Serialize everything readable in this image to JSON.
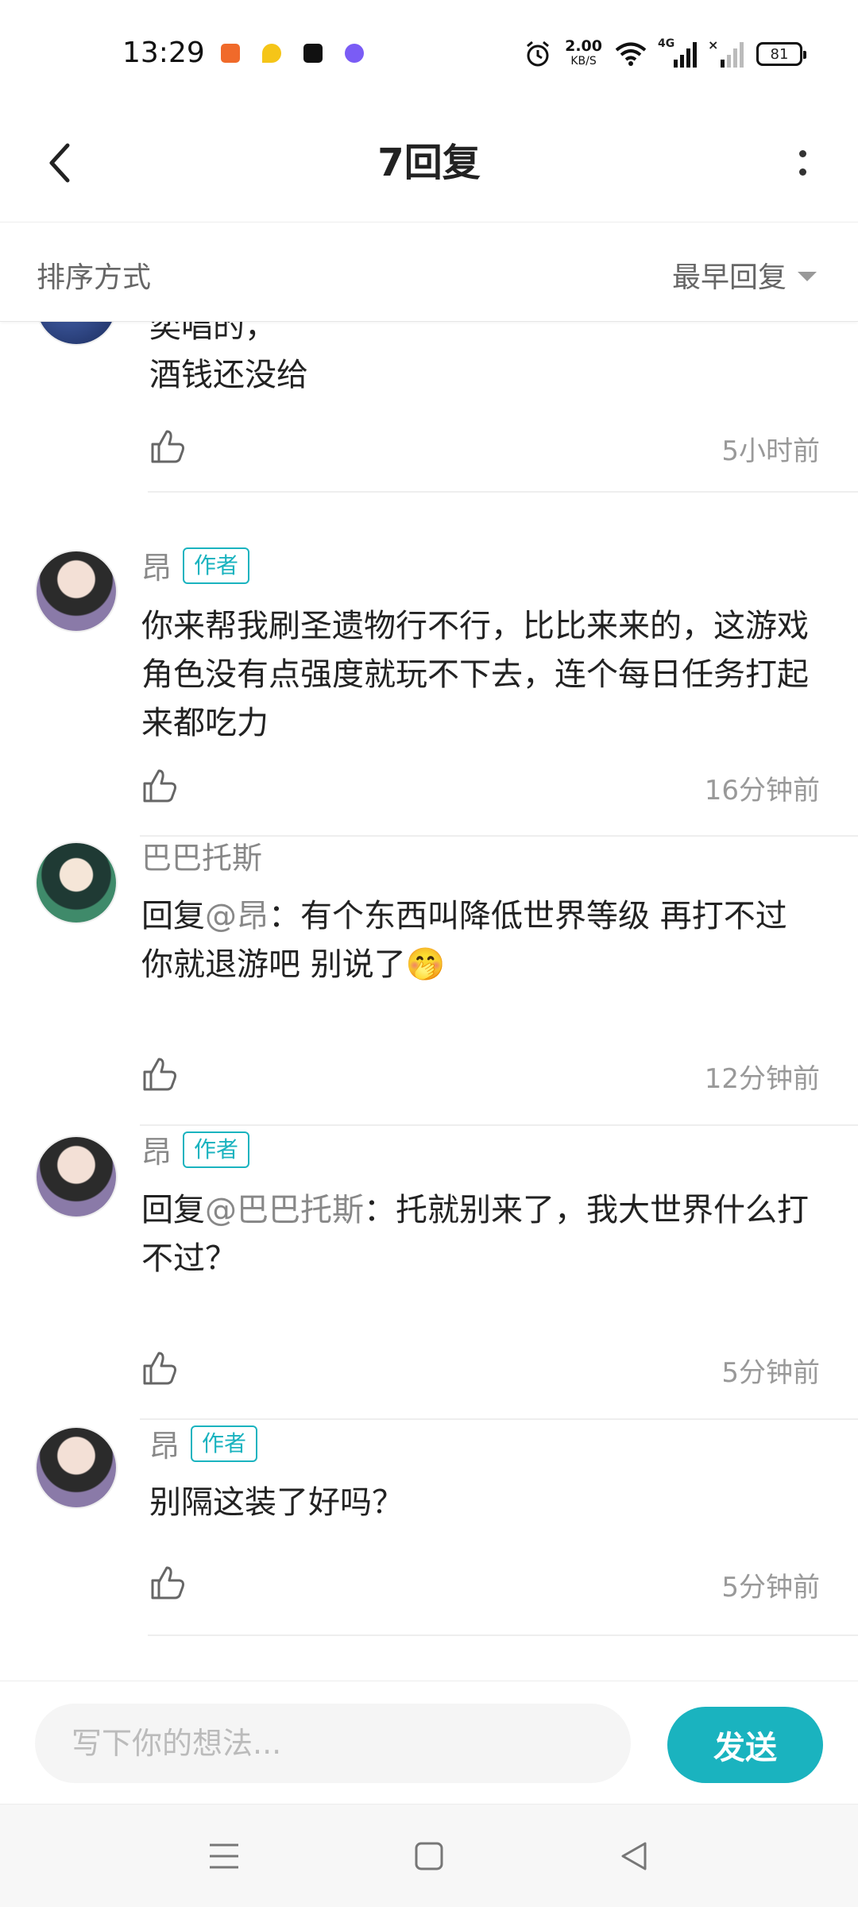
{
  "status_bar": {
    "time": "13:29",
    "net_speed": "2.00",
    "net_unit": "KB/S",
    "network": "4G",
    "battery": "81",
    "icons": [
      "alarm-icon",
      "wifi-icon",
      "signal-icon",
      "signal-empty-icon"
    ]
  },
  "header": {
    "title": "7回复"
  },
  "sort": {
    "label": "排序方式",
    "value": "最早回复"
  },
  "colors": {
    "accent": "#1ab3bf",
    "muted": "#888888",
    "text": "#222222"
  },
  "comments": [
    {
      "text_line1": "奕唱的，",
      "text_line2": "酒钱还没给",
      "time": "5小时前"
    },
    {
      "name": "昂",
      "badge": "作者",
      "text": "你来帮我刷圣遗物行不行，比比来来的，这游戏角色没有点强度就玩不下去，连个每日任务打起来都吃力",
      "time": "16分钟前"
    },
    {
      "name": "巴巴托斯",
      "reply_prefix": "回复",
      "mention": "@昂",
      "text": "：有个东西叫降低世界等级 再打不过你就退游吧 别说了🤭",
      "time": "12分钟前"
    },
    {
      "name": "昂",
      "badge": "作者",
      "reply_prefix": "回复",
      "mention": "@巴巴托斯",
      "text": "：托就别来了，我大世界什么打不过？",
      "time": "5分钟前"
    },
    {
      "name": "昂",
      "badge": "作者",
      "text": "别隔这装了好吗？",
      "time": "5分钟前"
    }
  ],
  "input": {
    "placeholder": "写下你的想法...",
    "send_label": "发送"
  },
  "nav": {
    "icons": [
      "menu-icon",
      "home-icon",
      "back-icon"
    ]
  }
}
